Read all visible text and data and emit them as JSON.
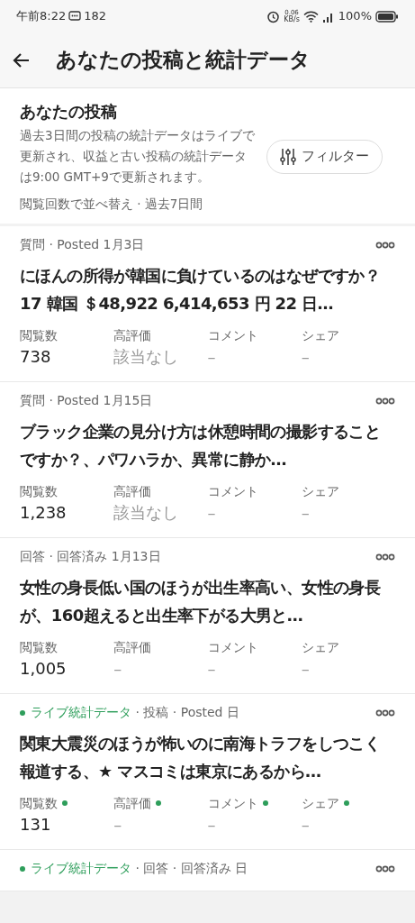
{
  "status_bar": {
    "time": "午前8:22",
    "count": "182",
    "speed": "0.06",
    "speed_unit": "KB/s",
    "battery": "100%"
  },
  "header": {
    "title": "あなたの投稿と統計データ"
  },
  "intro": {
    "title": "あなたの投稿",
    "description": "過去3日間の投稿の統計データはライブで更新され、収益と古い投稿の統計データは9:00 GMT+9で更新されます。",
    "filter_button": "フィルター",
    "sort": "閲覧回数で並べ替え · 過去7日間"
  },
  "posts": [
    {
      "live": false,
      "meta": "質問 · Posted 1月3日",
      "title": "にほんの所得が韓国に負けているのはなぜですか？17 韓国 ＄48,922 6,414,653 円 22 日…",
      "stats": [
        {
          "label": "閲覧数",
          "value": "738",
          "muted": false
        },
        {
          "label": "高評価",
          "value": "該当なし",
          "muted": true
        },
        {
          "label": "コメント",
          "value": "–",
          "muted": true
        },
        {
          "label": "シェア",
          "value": "–",
          "muted": true
        }
      ]
    },
    {
      "live": false,
      "meta": "質問 · Posted 1月15日",
      "title": "ブラック企業の見分け方は休憩時間の撮影することですか？、パワハラか、異常に静か…",
      "stats": [
        {
          "label": "閲覧数",
          "value": "1,238",
          "muted": false
        },
        {
          "label": "高評価",
          "value": "該当なし",
          "muted": true
        },
        {
          "label": "コメント",
          "value": "–",
          "muted": true
        },
        {
          "label": "シェア",
          "value": "–",
          "muted": true
        }
      ]
    },
    {
      "live": false,
      "meta": "回答 · 回答済み 1月13日",
      "title": "女性の身長低い国のほうが出生率高い、女性の身長が、160超えると出生率下がる大男と…",
      "stats": [
        {
          "label": "閲覧数",
          "value": "1,005",
          "muted": false
        },
        {
          "label": "高評価",
          "value": "–",
          "muted": true
        },
        {
          "label": "コメント",
          "value": "–",
          "muted": true
        },
        {
          "label": "シェア",
          "value": "–",
          "muted": true
        }
      ]
    },
    {
      "live": true,
      "live_label": "ライブ統計データ",
      "meta": " · 投稿 · Posted 日",
      "title": "関東大震災のほうが怖いのに南海トラフをしつこく報道する、★ マスコミは東京にあるから…",
      "stats": [
        {
          "label": "閲覧数",
          "value": "131",
          "muted": false
        },
        {
          "label": "高評価",
          "value": "–",
          "muted": true
        },
        {
          "label": "コメント",
          "value": "–",
          "muted": true
        },
        {
          "label": "シェア",
          "value": "–",
          "muted": true
        }
      ]
    },
    {
      "live": true,
      "live_label": "ライブ統計データ",
      "meta": " · 回答 · 回答済み 日"
    }
  ]
}
